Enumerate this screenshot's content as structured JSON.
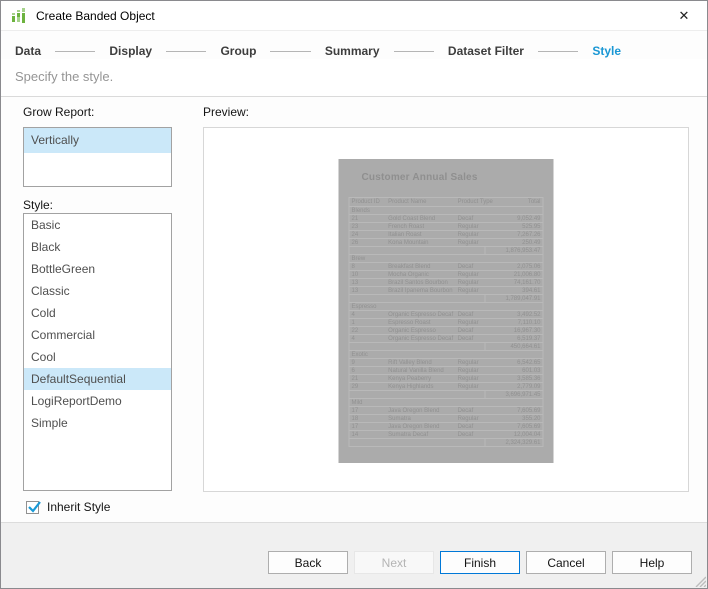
{
  "window": {
    "title": "Create Banded Object"
  },
  "icons": {
    "close": "✕",
    "app": "banded-object-icon",
    "check": "checkmark"
  },
  "steps": [
    {
      "label": "Data",
      "active": false
    },
    {
      "label": "Display",
      "active": false
    },
    {
      "label": "Group",
      "active": false
    },
    {
      "label": "Summary",
      "active": false
    },
    {
      "label": "Dataset Filter",
      "active": false
    },
    {
      "label": "Style",
      "active": true
    }
  ],
  "subtitle": "Specify the style.",
  "grow_report": {
    "label": "Grow Report:",
    "options": [
      "Vertically"
    ],
    "selected": "Vertically"
  },
  "style_list": {
    "label": "Style:",
    "options": [
      "Basic",
      "Black",
      "BottleGreen",
      "Classic",
      "Cold",
      "Commercial",
      "Cool",
      "DefaultSequential",
      "LogiReportDemo",
      "Simple"
    ],
    "selected": "DefaultSequential"
  },
  "preview": {
    "label": "Preview:",
    "report": {
      "title": "Customer Annual Sales",
      "columns": [
        "Product ID",
        "Product Name",
        "Product Type",
        "Total"
      ],
      "groups": [
        {
          "name": "Blends",
          "rows": [
            [
              "21",
              "Gold Coast Blend",
              "Decaf",
              "9,052.49"
            ],
            [
              "23",
              "French Roast",
              "Regular",
              "525.95"
            ],
            [
              "24",
              "Italian Roast",
              "Regular",
              "7,267.26"
            ],
            [
              "26",
              "Kona Mountain",
              "Regular",
              "250.49"
            ]
          ],
          "subtotal": "1,876,953.47"
        },
        {
          "name": "Brew",
          "rows": [
            [
              "8",
              "Breakfast Blend",
              "Decaf",
              "2,075.06"
            ],
            [
              "10",
              "Mocha Organic",
              "Regular",
              "21,006.80"
            ],
            [
              "13",
              "Brazil Santos Bourbon",
              "Regular",
              "74,161.70"
            ],
            [
              "13",
              "Brazil Ipanema Bourbon",
              "Regular",
              "394.61"
            ]
          ],
          "subtotal": "1,789,047.91"
        },
        {
          "name": "Espresso",
          "rows": [
            [
              "4",
              "Organic Espresso Decaf",
              "Decaf",
              "3,492.52"
            ],
            [
              "1",
              "Espresso Roast",
              "Regular",
              "7,110.10"
            ],
            [
              "22",
              "Organic Espresso",
              "Decaf",
              "16,967.30"
            ],
            [
              "4",
              "Organic Espresso Decaf",
              "Decaf",
              "6,519.37"
            ]
          ],
          "subtotal": "450,664.61"
        },
        {
          "name": "Exotic",
          "rows": [
            [
              "9",
              "Rift Valley Blend",
              "Regular",
              "6,542.65"
            ],
            [
              "6",
              "Natural Vanilla Blend",
              "Regular",
              "601.03"
            ],
            [
              "21",
              "Kenya Peaberry",
              "Regular",
              "3,585.36"
            ],
            [
              "29",
              "Kenya Highlands",
              "Regular",
              "2,779.09"
            ]
          ],
          "subtotal": "3,696,971.45"
        },
        {
          "name": "Mild",
          "rows": [
            [
              "17",
              "Java Oregon Blend",
              "Decaf",
              "7,605.69"
            ],
            [
              "18",
              "Sumatra",
              "Regular",
              "355.20"
            ],
            [
              "17",
              "Java Oregon Blend",
              "Decaf",
              "7,605.69"
            ],
            [
              "14",
              "Sumatra Decaf",
              "Decaf",
              "12,004.04"
            ]
          ],
          "subtotal": "2,324,329.61"
        }
      ]
    }
  },
  "inherit_style": {
    "label": "Inherit Style",
    "checked": true
  },
  "footer_buttons": [
    {
      "label": "Back",
      "enabled": true,
      "default": false
    },
    {
      "label": "Next",
      "enabled": false,
      "default": false
    },
    {
      "label": "Finish",
      "enabled": true,
      "default": true
    },
    {
      "label": "Cancel",
      "enabled": true,
      "default": false
    },
    {
      "label": "Help",
      "enabled": true,
      "default": false
    }
  ],
  "colors": {
    "accent": "#1a97d4",
    "selection": "#cbe8f9",
    "default_button_border": "#0078d7",
    "preview_report_bg": "#ababab",
    "icon_green_light": "#a5d28a",
    "icon_green_dark": "#6db33f"
  }
}
